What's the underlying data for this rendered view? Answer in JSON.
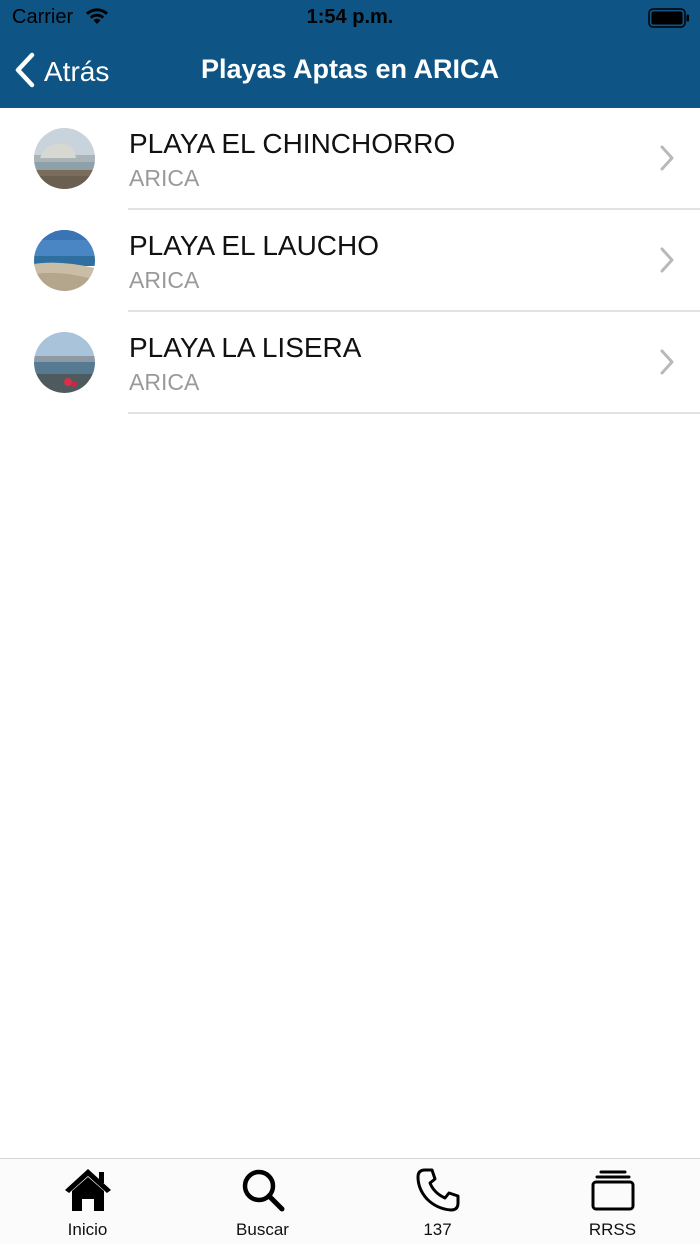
{
  "status_bar": {
    "carrier": "Carrier",
    "time": "1:54 p.m."
  },
  "nav": {
    "back_label": "Atrás",
    "title": "Playas Aptas en ARICA"
  },
  "beaches": [
    {
      "name": "PLAYA EL CHINCHORRO",
      "city": "ARICA",
      "thumbnail_icon": "beach-photo-chinchorro"
    },
    {
      "name": "PLAYA EL LAUCHO",
      "city": "ARICA",
      "thumbnail_icon": "beach-photo-laucho"
    },
    {
      "name": "PLAYA LA LISERA",
      "city": "ARICA",
      "thumbnail_icon": "beach-photo-lisera"
    }
  ],
  "tabs": [
    {
      "label": "Inicio",
      "icon": "home-icon"
    },
    {
      "label": "Buscar",
      "icon": "search-icon"
    },
    {
      "label": "137",
      "icon": "phone-icon"
    },
    {
      "label": "RRSS",
      "icon": "stack-icon"
    }
  ],
  "colors": {
    "nav_background": "#0e5586",
    "nav_text": "#ffffff",
    "subtitle_text": "#9a9a9a"
  }
}
